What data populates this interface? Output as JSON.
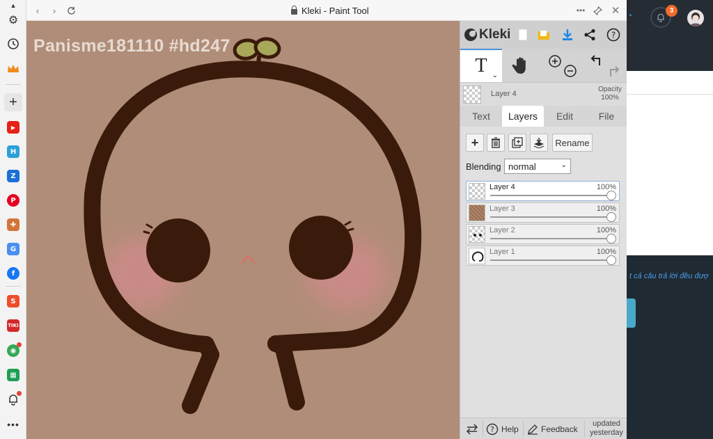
{
  "window": {
    "title": "Kleki - Paint Tool"
  },
  "canvas": {
    "watermark": "Panisme181110 #hd247"
  },
  "panel": {
    "logo": "Kleki",
    "layer_info": {
      "name": "Layer 4",
      "opacity_label": "Opacity",
      "opacity_value": "100%"
    },
    "tabs": [
      {
        "label": "Text"
      },
      {
        "label": "Layers"
      },
      {
        "label": "Edit"
      },
      {
        "label": "File"
      }
    ],
    "rename_label": "Rename",
    "blending_label": "Blending",
    "blending_value": "normal",
    "layers": [
      {
        "name": "Layer 4",
        "opacity": "100%",
        "opacity_value": 1.0
      },
      {
        "name": "Layer 3",
        "opacity": "100%",
        "opacity_value": 1.0
      },
      {
        "name": "Layer 2",
        "opacity": "100%",
        "opacity_value": 1.0
      },
      {
        "name": "Layer 1",
        "opacity": "100%",
        "opacity_value": 1.0
      }
    ],
    "bottom": {
      "help": "Help",
      "feedback": "Feedback",
      "updated_line1": "updated",
      "updated_line2": "yesterday"
    }
  },
  "background_page": {
    "notification_count": "3",
    "link_text": "t cả câu trả lời đều đượ"
  },
  "colors": {
    "canvas_bg": "#b08d78",
    "stroke": "#3a1a0a",
    "blush": "#c98a86",
    "sprout": "#a7a85a",
    "accent_blue": "#1e88e5",
    "folder_yellow": "#f5b70f"
  }
}
